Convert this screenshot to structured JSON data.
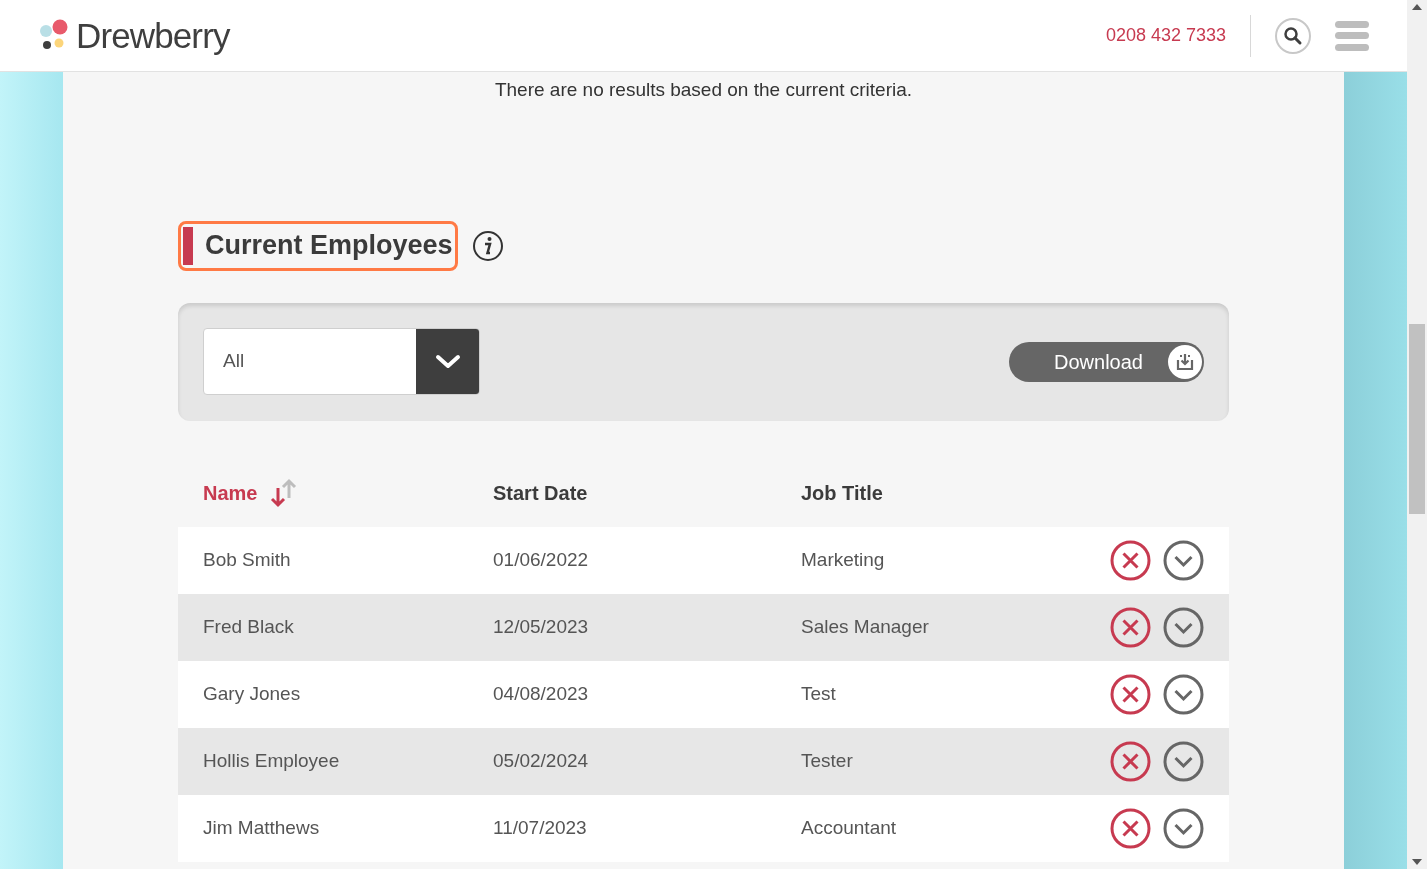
{
  "header": {
    "brand": "Drewberry",
    "phone": "0208 432 7333"
  },
  "notice": "There are no results based on the current criteria.",
  "section": {
    "title": "Current Employees"
  },
  "filter": {
    "value": "All"
  },
  "download_button": "Download",
  "table": {
    "columns": [
      {
        "label": "Name",
        "sorted": true
      },
      {
        "label": "Start Date",
        "sorted": false
      },
      {
        "label": "Job Title",
        "sorted": false
      }
    ],
    "rows": [
      {
        "name": "Bob Smith",
        "start_date": "01/06/2022",
        "job_title": "Marketing"
      },
      {
        "name": "Fred Black",
        "start_date": "12/05/2023",
        "job_title": "Sales Manager"
      },
      {
        "name": "Gary Jones",
        "start_date": "04/08/2023",
        "job_title": "Test"
      },
      {
        "name": "Hollis Employee",
        "start_date": "05/02/2024",
        "job_title": "Tester"
      },
      {
        "name": "Jim Matthews",
        "start_date": "11/07/2023",
        "job_title": "Accountant"
      }
    ]
  }
}
